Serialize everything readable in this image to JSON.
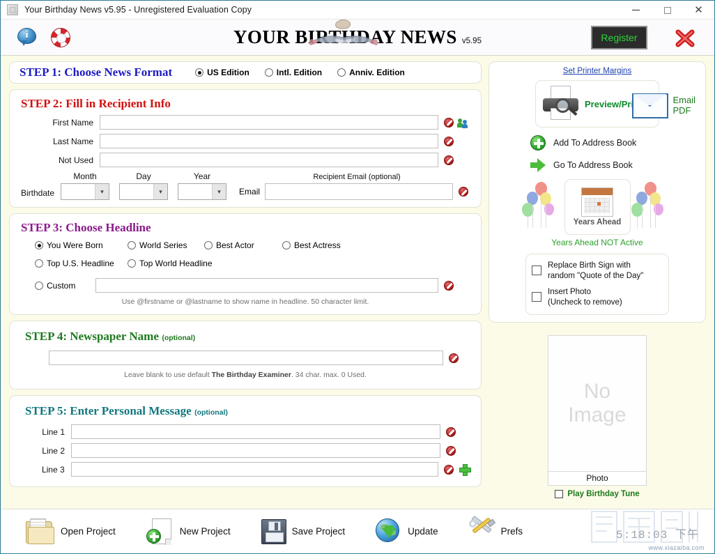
{
  "window": {
    "title": "Your Birthday News v5.95 - Unregistered Evaluation Copy",
    "minimize": "—",
    "maximize": "□",
    "close": "✕"
  },
  "header": {
    "info_icon": "info-icon",
    "help_icon": "lifebuoy-icon",
    "logo_text": "YOUR BIRTHDAY NEWS",
    "version": "v5.95",
    "register_label": "Register",
    "close_icon": "red-x-icon"
  },
  "step1": {
    "title": "STEP 1: Choose News Format",
    "options": [
      {
        "label": "US Edition",
        "selected": true
      },
      {
        "label": "Intl. Edition",
        "selected": false
      },
      {
        "label": "Anniv. Edition",
        "selected": false
      }
    ]
  },
  "step2": {
    "title": "STEP 2: Fill in Recipient Info",
    "fields": [
      {
        "label": "First Name",
        "value": "",
        "placeholder": ""
      },
      {
        "label": "Last Name",
        "value": "",
        "placeholder": ""
      },
      {
        "label": "Not Used",
        "value": "",
        "placeholder": ""
      }
    ],
    "birthdate_label": "Birthdate",
    "month_label": "Month",
    "day_label": "Day",
    "year_label": "Year",
    "month_value": "",
    "day_value": "",
    "year_value": "",
    "email_header": "Recipient Email (optional)",
    "email_label": "Email",
    "email_value": ""
  },
  "step3": {
    "title": "STEP 3: Choose Headline",
    "options": [
      {
        "label": "You Were Born",
        "selected": true
      },
      {
        "label": "World Series",
        "selected": false
      },
      {
        "label": "Best Actor",
        "selected": false
      },
      {
        "label": "Best Actress",
        "selected": false
      },
      {
        "label": "Top U.S. Headline",
        "selected": false
      },
      {
        "label": "Top World Headline",
        "selected": false
      }
    ],
    "custom_label": "Custom",
    "custom_value": "",
    "hint": "Use @firstname or @lastname to show name in headline. 50 character limit."
  },
  "step4": {
    "title": "STEP 4: Newspaper Name",
    "optional": "(optional)",
    "value": "",
    "hint_pre": "Leave blank to use default ",
    "hint_bold": "The Birthday Examiner",
    "hint_post": ". 34 char. max. 0 Used."
  },
  "step5": {
    "title": "STEP 5: Enter Personal Message",
    "optional": "(optional)",
    "lines": [
      {
        "label": "Line 1",
        "value": ""
      },
      {
        "label": "Line 2",
        "value": ""
      },
      {
        "label": "Line 3",
        "value": ""
      }
    ]
  },
  "right": {
    "printer_margins_link": "Set Printer Margins",
    "preview_print": "Preview/Print",
    "email_pdf_line1": "Email",
    "email_pdf_line2": "PDF",
    "add_address_book": "Add To Address Book",
    "go_address_book": "Go To Address Book",
    "years_ahead_button": "Years Ahead",
    "years_ahead_status": "Years Ahead NOT Active",
    "checkboxes": [
      {
        "line1": "Replace Birth Sign with",
        "line2": "random \"Quote of the Day\"",
        "checked": false
      },
      {
        "line1": "Insert Photo",
        "line2": "(Uncheck to remove)",
        "checked": false
      }
    ],
    "photo_placeholder_line1": "No",
    "photo_placeholder_line2": "Image",
    "photo_caption": "Photo",
    "play_tune_label": "Play Birthday Tune",
    "play_tune_checked": false
  },
  "toolbar": {
    "items": [
      {
        "label": "Open Project",
        "icon": "folder-icon"
      },
      {
        "label": "New Project",
        "icon": "new-document-icon"
      },
      {
        "label": "Save Project",
        "icon": "floppy-disk-icon"
      },
      {
        "label": "Update",
        "icon": "globe-download-icon"
      },
      {
        "label": "Prefs",
        "icon": "tools-icon"
      }
    ],
    "clock": "5:18:03 下午",
    "watermark_url": "www.xiazaiba.com"
  },
  "colors": {
    "page_bg": "#FBFBE8",
    "step1_title": "#1B1BC4",
    "step2_title": "#D01111",
    "step3_title": "#8B1A8B",
    "step4_title": "#1D7A1D",
    "step5_title": "#12777E",
    "register_text": "#28D836",
    "link": "#1B3FAE",
    "green_status": "#2AA02A"
  }
}
